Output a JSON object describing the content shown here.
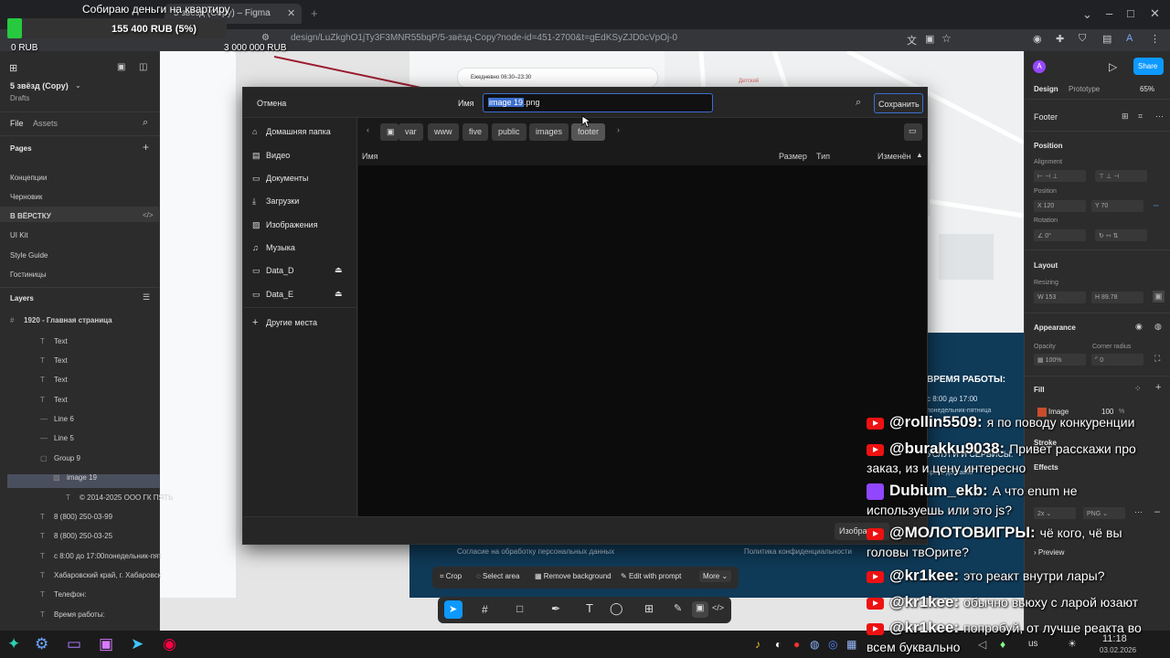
{
  "browser": {
    "tab_title": "5 звёзд (Copy) – Figma",
    "url": "design/LuZkghO1jTy3F3MNR55bqP/5-звёзд-Copy?node-id=451-2700&t=gEdKSyZJD0cVpOj-0"
  },
  "donation": {
    "title": "Собираю деньги на квартиру",
    "amount": "155 400 RUB (5%)",
    "progress": 0.05,
    "min": "0 RUB",
    "goal": "3 000 000 RUB"
  },
  "left": {
    "file_name": "5 звёзд (Copy)",
    "drafts": "Drafts",
    "tab_file": "File",
    "tab_assets": "Assets",
    "pages_title": "Pages",
    "pages": [
      "Концепции",
      "Черновик",
      "В ВЁРСТКУ",
      "UI Kit",
      "Style Guide",
      "Гостиницы"
    ],
    "layers_title": "Layers",
    "frame": "1920 - Главная страница",
    "layers": [
      "Text",
      "Text",
      "Text",
      "Text",
      "Line 6",
      "Line 5",
      "Group 9",
      "image 19",
      "© 2014-2025 ООО ГК ПЯТЬ",
      "8 (800) 250-03-99",
      "8 (800) 250-03-25",
      "с 8:00 до 17:00понедельник-пят",
      "Хабаровский край, г. Хабаровск",
      "Телефон:",
      "Время работы:"
    ]
  },
  "canvas": {
    "hours": "Ежедневно 06:30–23:30",
    "map_label": "Детский",
    "footer_heading": "ВРЕМЯ РАБОТЫ:",
    "footer_hours": "с 8:00 до 17:00",
    "footer_days": "понедельник-пятница",
    "footer_services": "УСЛУГИ И СЕРВИСЫ:",
    "footer_delivery": "пресс-доставка",
    "consent": "Согласие на обработку персональных данных",
    "privacy": "Политика конфиденциальности"
  },
  "dialog": {
    "cancel": "Отмена",
    "name_label": "Имя",
    "filename_sel": "image 19",
    "filename_ext": ".png",
    "save": "Сохранить",
    "sidebar": [
      "Домашняя папка",
      "Видео",
      "Документы",
      "Загрузки",
      "Изображения",
      "Музыка",
      "Data_D",
      "Data_E"
    ],
    "other_places": "Другие места",
    "crumbs": [
      "var",
      "www",
      "five",
      "public",
      "images",
      "footer"
    ],
    "columns": {
      "name": "Имя",
      "size": "Размер",
      "type": "Тип",
      "modified": "Изменён"
    },
    "filter": "Изобра"
  },
  "ai_bar": [
    "Crop",
    "Select area",
    "Remove background",
    "Edit with prompt",
    "More"
  ],
  "right": {
    "avatar": "A",
    "share": "Share",
    "tab_design": "Design",
    "tab_prototype": "Prototype",
    "zoom": "65%",
    "selection": "Footer",
    "position_title": "Position",
    "alignment": "Alignment",
    "position_label": "Position",
    "x": "120",
    "y": "70",
    "rotation_label": "Rotation",
    "rotation": "0°",
    "layout_title": "Layout",
    "resizing": "Resizing",
    "w": "153",
    "h": "89.78",
    "appearance_title": "Appearance",
    "opacity_label": "Opacity",
    "opacity": "100%",
    "radius_label": "Corner radius",
    "radius": "0",
    "fill_title": "Fill",
    "fill_type": "Image",
    "fill_opacity": "100",
    "fill_pct": "%",
    "stroke_title": "Stroke",
    "effects_title": "Effects",
    "export_scale": "2x",
    "export_format": "PNG",
    "preview": "Preview"
  },
  "taskbar": {
    "lang": "us",
    "time": "11:18",
    "date": "03.02.2026"
  },
  "chat": [
    {
      "platform": "youtube",
      "user": "@rollin5509:",
      "lines": [
        "я по поводу конкуренции"
      ]
    },
    {
      "platform": "youtube",
      "user": "@burakku9038:",
      "lines": [
        "Привет расскажи про",
        "заказ, из и цену интересно"
      ]
    },
    {
      "platform": "twitch",
      "user": "Dubium_ekb:",
      "lines": [
        "А что enum не",
        "используешь или это js?"
      ]
    },
    {
      "platform": "youtube",
      "user": "@МОЛОТОВИГРЫ:",
      "lines": [
        "чё кого, чё вы",
        "головы твОрите?"
      ]
    },
    {
      "platform": "youtube",
      "user": "@kr1kee:",
      "lines": [
        "это реакт внутри лары?"
      ]
    },
    {
      "platform": "youtube",
      "user": "@kr1kee:",
      "lines": [
        "обычно вьюху с ларой юзают"
      ]
    },
    {
      "platform": "youtube",
      "user": "@kr1kee:",
      "lines": [
        "попробуй, от лучше реакта во",
        "всем буквально"
      ]
    }
  ]
}
